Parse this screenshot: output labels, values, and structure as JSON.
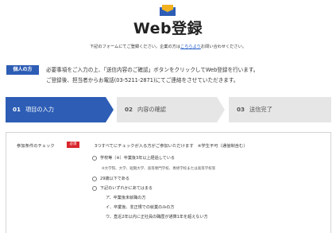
{
  "header": {
    "logo_icon": "envelope-icon",
    "title": "Web登録",
    "subtitle_before": "下記のフォームにてご登録ください。企業の方は",
    "subtitle_link": "こちらより",
    "subtitle_after": "お問い合わせください。"
  },
  "intro": {
    "badge": "個人の方",
    "line1": "必要事項をご入力の上、「送信内容のご確認」ボタンをクリックしてWeb登録を行います。",
    "line2": "ご登録後、担当者からお電話(03-5211-2871)にてご連絡をさせていただきます。"
  },
  "steps": [
    {
      "num": "01",
      "label": "項目の入力"
    },
    {
      "num": "02",
      "label": "内容の確認"
    },
    {
      "num": "03",
      "label": "送信完了"
    }
  ],
  "form": {
    "field_label": "参加条件のチェック",
    "required": "必須",
    "note": "3つすべてにチェックが入る方がご参加いただけます　※学生不可（通信制含む）",
    "options": [
      {
        "label": "学校等（※）卒業後3年以上経過している",
        "sub": "※大学院、大学、短期大学、高等専門学校、専修学校または高等学校等"
      },
      {
        "label": "29歳以下である"
      },
      {
        "label": "下記のいずれかにあてはまる"
      }
    ],
    "conditions": [
      "ア、卒業後未就職の方",
      "イ、卒業後、非正規での就業のみの方",
      "ウ、直近2年以内に正社員の職歴が通算1年を超えない方"
    ]
  },
  "colors": {
    "accent": "#2d5db5",
    "required": "#d9262c",
    "step_inactive": "#e6e6e6",
    "link": "#1a57c9"
  }
}
